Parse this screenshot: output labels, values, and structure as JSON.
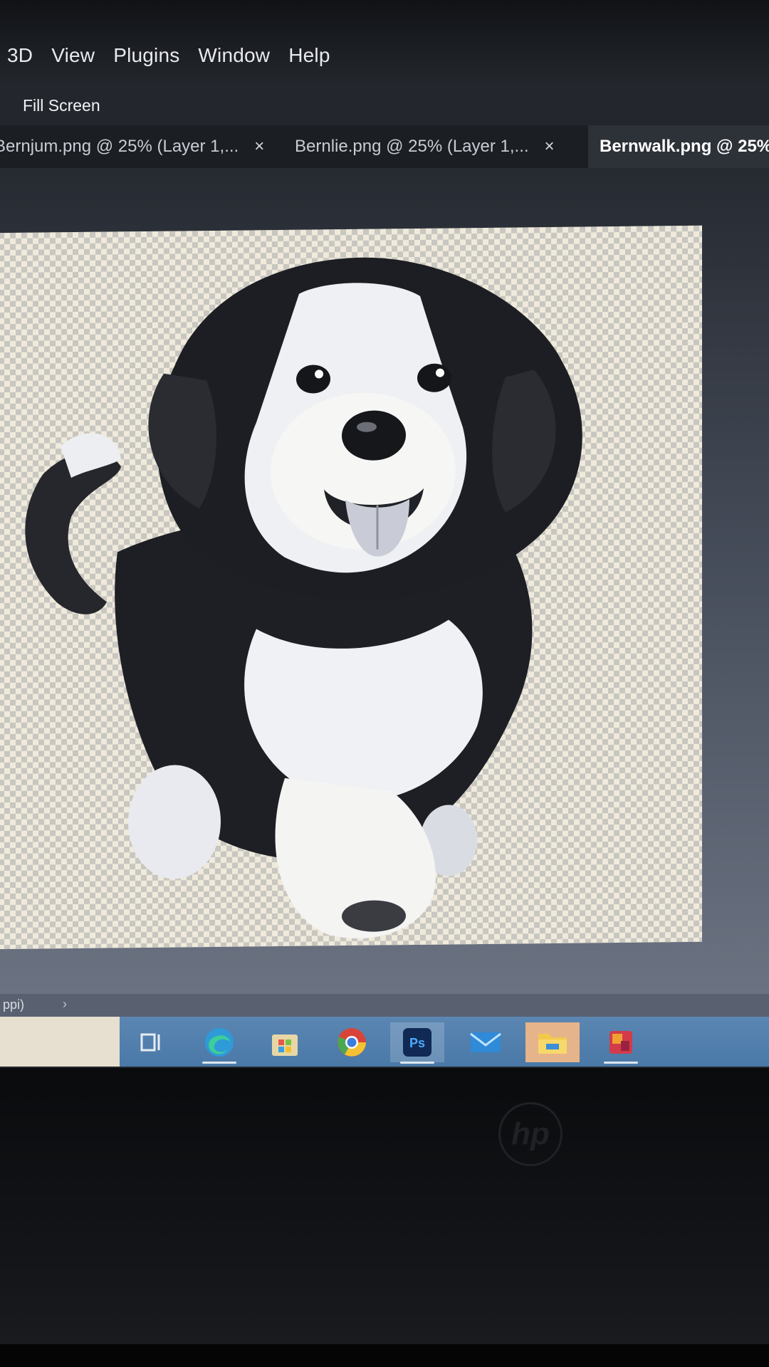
{
  "menubar": {
    "items": [
      "3D",
      "View",
      "Plugins",
      "Window",
      "Help"
    ]
  },
  "options_bar": {
    "fill_screen_label": "Fill Screen"
  },
  "tabs": [
    {
      "label": "Bernjum.png @ 25% (Layer 1,...",
      "active": false
    },
    {
      "label": "Bernlie.png @ 25% (Layer 1,...",
      "active": false
    },
    {
      "label": "Bernwalk.png @ 25%",
      "active": true
    }
  ],
  "tab_close_glyph": "×",
  "canvas": {
    "subject": "dog-illustration",
    "background": "transparency-checkerboard"
  },
  "statusbar": {
    "text": "ppi)",
    "arrow": "›"
  },
  "taskbar": {
    "icons": [
      "task-view-icon",
      "edge-icon",
      "store-icon",
      "chrome-icon",
      "photoshop-icon",
      "mail-icon",
      "file-explorer-icon",
      "app-icon"
    ],
    "photoshop_label": "Ps"
  },
  "bezel": {
    "logo": "hp"
  },
  "colors": {
    "menubar": "#1e2126",
    "tabbar": "#1b1e23",
    "active_tab": "#2d3138",
    "taskbar": "#4a79a8",
    "photoshop_blue": "#2b5fae"
  }
}
